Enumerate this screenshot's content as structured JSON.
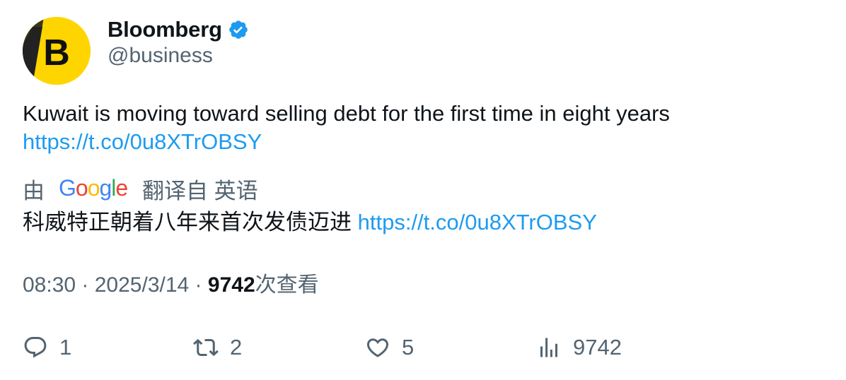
{
  "author": {
    "display_name": "Bloomberg",
    "handle": "@business",
    "avatar_letter": "B",
    "verified": true,
    "verified_icon": "verified-badge-icon",
    "brand_color": "#ffd500",
    "verified_color": "#1d9bf0"
  },
  "tweet": {
    "text": "Kuwait is moving toward selling debt for the first time in eight years",
    "link": "https://t.co/0u8XTrOBSY"
  },
  "translation": {
    "prefix": "由",
    "provider_logo": "Google",
    "suffix": "翻译自 英语",
    "text": "科威特正朝着八年来首次发债迈进",
    "link": "https://t.co/0u8XTrOBSY"
  },
  "meta": {
    "time": "08:30",
    "separator": " · ",
    "date": "2025/3/14",
    "views_count": "9742",
    "views_label": "次查看"
  },
  "actions": {
    "reply": {
      "icon": "reply-icon",
      "count": "1"
    },
    "retweet": {
      "icon": "retweet-icon",
      "count": "2"
    },
    "like": {
      "icon": "heart-icon",
      "count": "5"
    },
    "views": {
      "icon": "analytics-icon",
      "count": "9742"
    }
  },
  "colors": {
    "text": "#0f1419",
    "secondary": "#536471",
    "link": "#1d9bf0"
  }
}
